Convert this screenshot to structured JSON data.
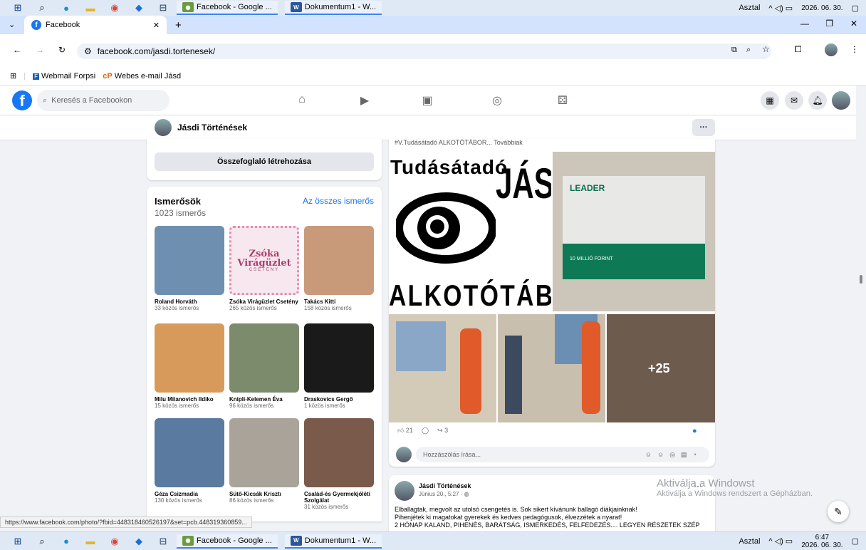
{
  "taskbar": {
    "apps": [
      {
        "label": "Facebook - Google ..."
      },
      {
        "label": "Dokumentum1 - W..."
      }
    ],
    "desktop_label": "Asztal",
    "date": "2026. 06. 30.",
    "time": "6:47"
  },
  "browser": {
    "tab_title": "Facebook",
    "url": "facebook.com/jasdi.tortenesek/",
    "bookmarks": [
      {
        "label": "Webmail Forpsi"
      },
      {
        "label": "Webes e-mail Jásd"
      }
    ]
  },
  "fb": {
    "search_placeholder": "Keresés a Facebookon",
    "page_name": "Jásdi Történések",
    "more_label": "···"
  },
  "summary": {
    "button": "Összefoglaló létrehozása"
  },
  "friends": {
    "title": "Ismerősök",
    "count": "1023 ismerős",
    "see_all": "Az összes ismerős",
    "items": [
      {
        "name": "Roland Horváth",
        "mutual": "33 közös ismerős",
        "color": "#6f8fb0"
      },
      {
        "name": "Zsóka Virágüzlet Csetény",
        "mutual": "265 közös ismerős",
        "color": "#f6e8ee",
        "logo_text": "Zsóka Virágüzlet",
        "logo_sub": "CSETÉNY"
      },
      {
        "name": "Takács Kitti",
        "mutual": "158 közös ismerős",
        "color": "#c99a7a"
      },
      {
        "name": "Milu Milanovich Ildiko",
        "mutual": "15 közös ismerős",
        "color": "#d89a5a"
      },
      {
        "name": "Knipli-Kelemen Éva",
        "mutual": "96 közös ismerős",
        "color": "#7d8b6d"
      },
      {
        "name": "Draskovics Gergő",
        "mutual": "1 közös ismerős",
        "color": "#1a1a1a"
      },
      {
        "name": "Géza Csizmadia",
        "mutual": "130 közös ismerős",
        "color": "#5a7aa0"
      },
      {
        "name": "Sütő-Kicsák Krisztı",
        "mutual": "86 közös ismerős",
        "color": "#a9a39a"
      },
      {
        "name": "Család-és Gyermekjóléti Szolgálat",
        "mutual": "31 közös ismerős",
        "color": "#7a5a4a"
      }
    ]
  },
  "post1": {
    "caption_snip": "#V.Tudásátadó ALKOTÓTÁBOR... Továbbiak",
    "img1_line1": "Tudásátadó",
    "img1_big": "JÁS",
    "img1_bottom": "ALKOTÓTÁB",
    "leader": "LEADER",
    "leader_sum": "10 MILLIÓ FORINT",
    "more_photos": "+25",
    "likes": "21",
    "shares": "3",
    "comment_placeholder": "Hozzászólás írása..."
  },
  "post2": {
    "author": "Jásdi Történések",
    "meta": "Június 20., 5:27 · ",
    "line1": "Elballagtak, megvolt az utolsó csengetés is. Sok sikert kívánunk ballagó diákjainknak!",
    "line2": "Pihenjétek ki magatokat gyerekek és kedves pedagógusok, élvezzétek a nyarat!",
    "line3": "2 HÓNAP KALAND, PIHENÉS, BARÁTSÁG, ISMERKEDÉS, FELFEDEZÉS.... LEGYEN RÉSZETEK SZÉP",
    "more": "···"
  },
  "status_url": "https://www.facebook.com/photo/?fbid=448318460526197&set=pcb.448319360859...",
  "watermark": {
    "title": "Aktiválja a Windowst",
    "sub": "Aktiválja a Windows rendszert a Gépházban."
  }
}
